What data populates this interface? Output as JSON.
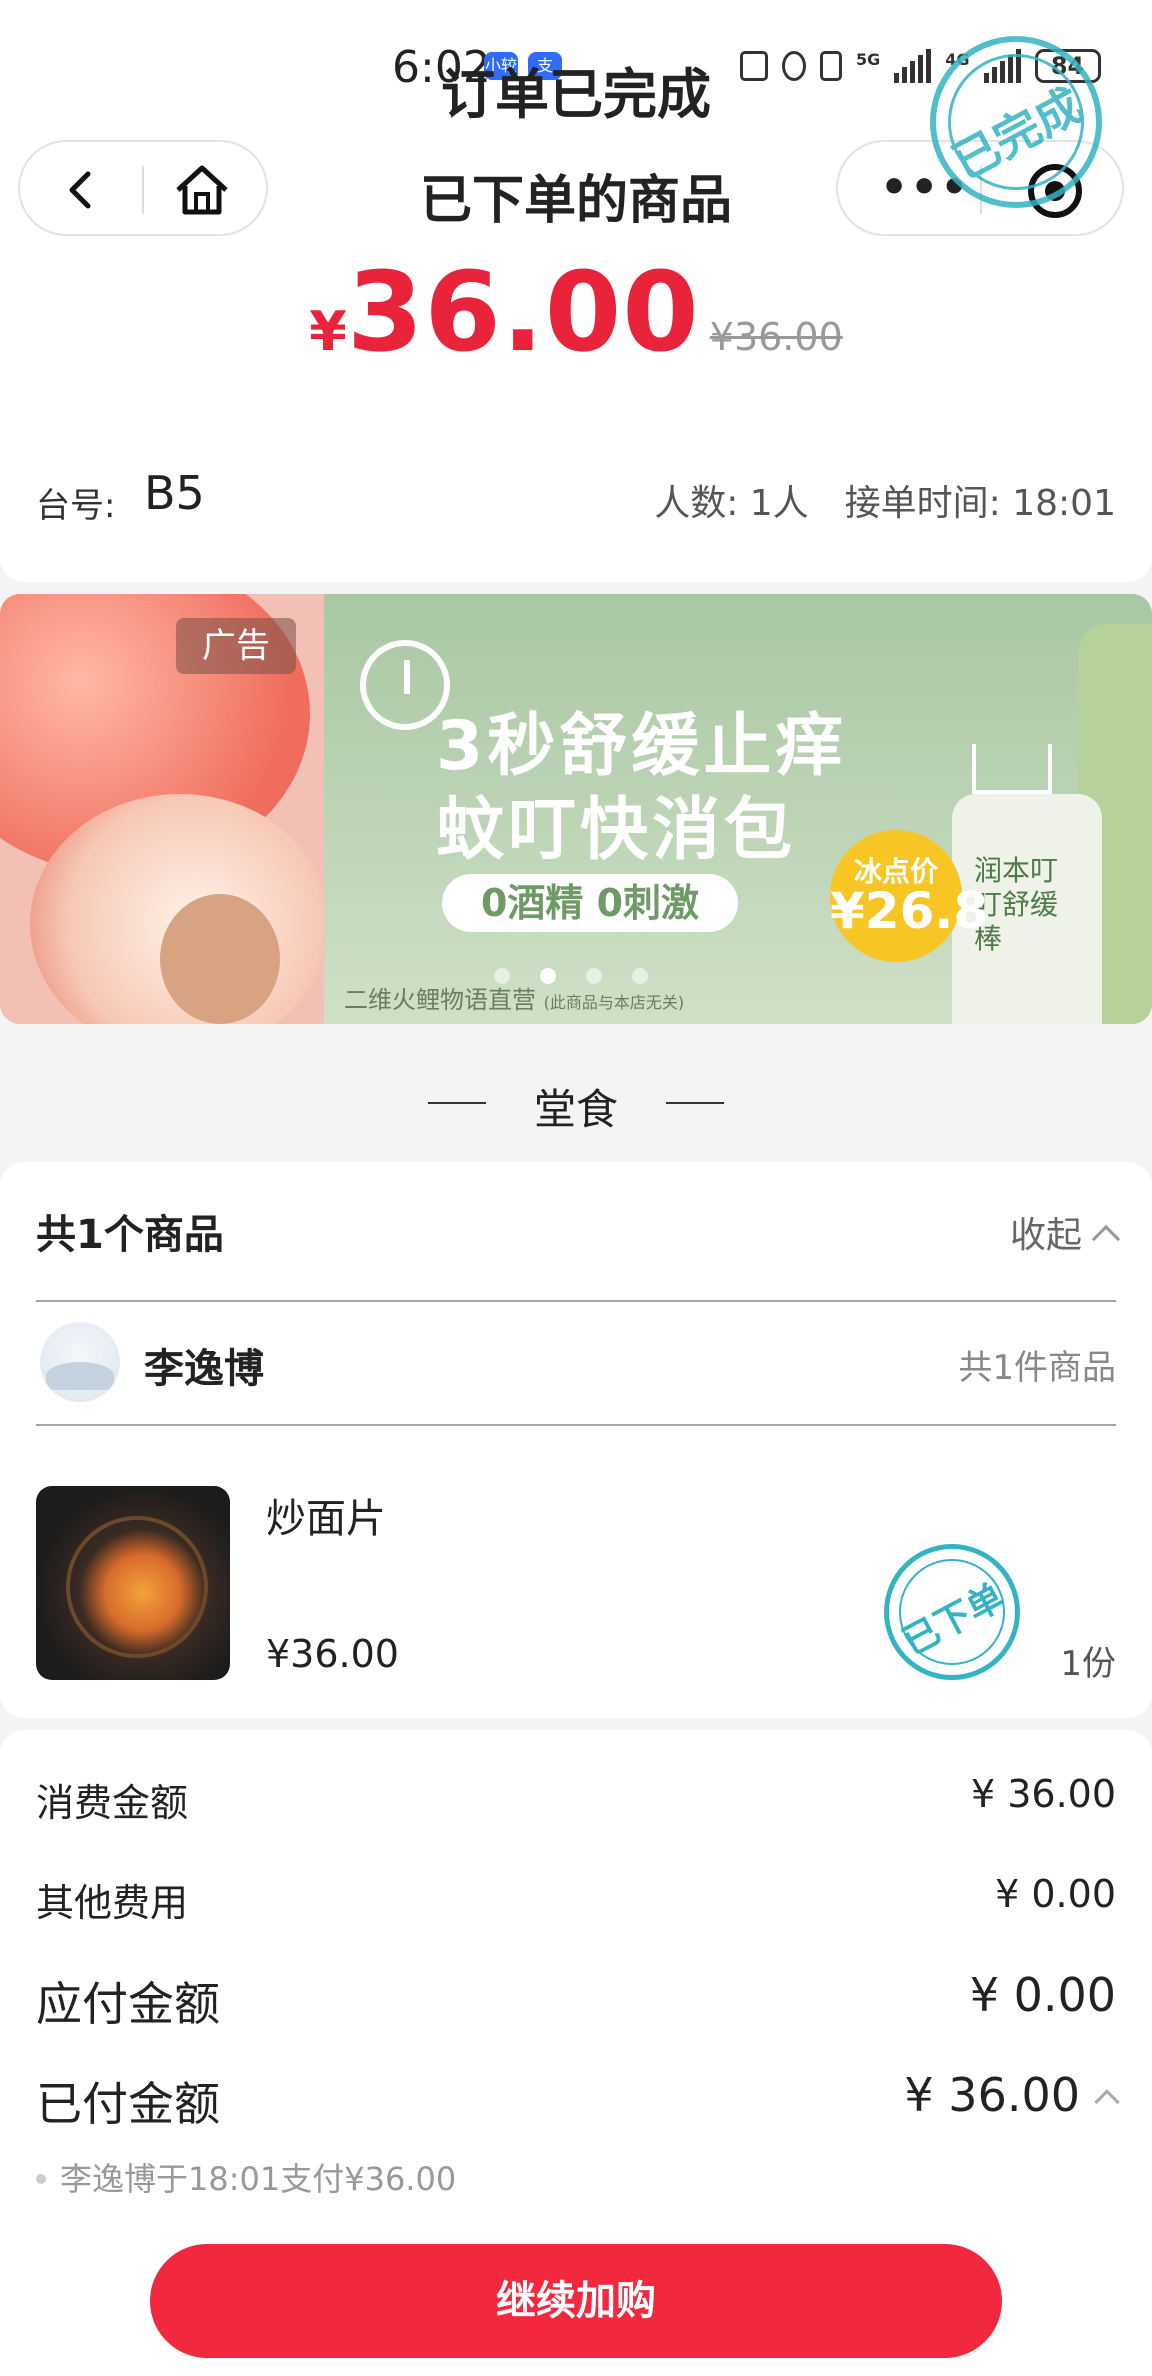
{
  "status_bar": {
    "time": "6:02",
    "mini_badge": "小较",
    "alipay_badge": "支",
    "net1": "5G",
    "net2": "4G",
    "battery": "84"
  },
  "header": {
    "order_status": "订单已完成",
    "subtitle": "已下单的商品",
    "stamp": "已完成"
  },
  "price": {
    "currency": "¥",
    "amount": "36.00",
    "original": "¥36.00"
  },
  "order_info": {
    "table_label": "台号:",
    "table_value": "B5",
    "people": "人数:  1人",
    "accept_time": "接单时间:  18:01"
  },
  "ad": {
    "tag": "广告",
    "line1": "3秒舒缓止痒",
    "line2": "蚊叮快消包",
    "pill": "0酒精 0刺激",
    "badge_label": "冰点价",
    "badge_price": "¥26.8",
    "product_text": "润本叮叮舒缓棒",
    "source": "二维火鲤物语直营",
    "source_note": "(此商品与本店无关)"
  },
  "section": {
    "title": "堂食"
  },
  "items": {
    "count_title": "共1个商品",
    "collapse": "收起",
    "person_name": "李逸博",
    "person_count": "共1件商品",
    "food_name": "炒面片",
    "food_price": "¥36.00",
    "food_qty": "1份",
    "ordered_stamp": "已下单"
  },
  "summary": {
    "consume_label": "消费金额",
    "consume_value": "¥ 36.00",
    "other_label": "其他费用",
    "other_value": "¥ 0.00",
    "payable_label": "应付金额",
    "payable_value": "¥ 0.00",
    "paid_label": "已付金额",
    "paid_value": "¥ 36.00",
    "pay_note": "李逸博于18:01支付¥36.00"
  },
  "actions": {
    "continue_label": "继续加购"
  },
  "colors": {
    "accent_red": "#e8233a",
    "button_red": "#f2283e",
    "stamp_teal": "#34b3c4"
  }
}
